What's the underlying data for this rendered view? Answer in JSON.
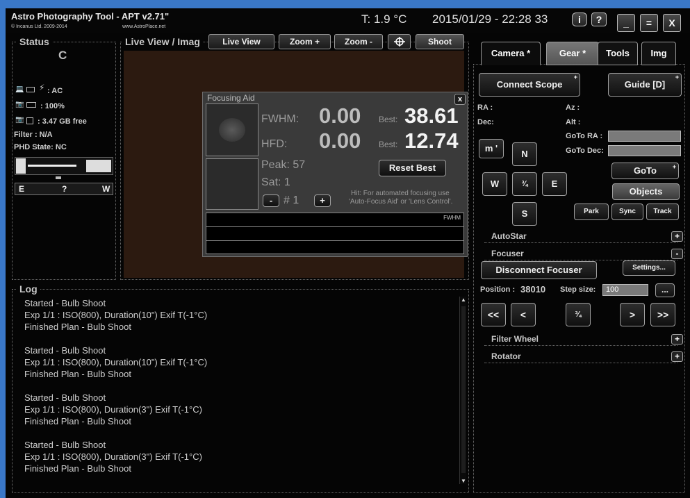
{
  "titlebar": {
    "app_title": "Astro Photography Tool - APT v2.71\"",
    "copyright": "© Incanus Ltd. 2009-2014",
    "website": "www.AstroPlace.net",
    "temperature": "T: 1.9 °C",
    "datetime": "2015/01/29 - 22:28 33",
    "info_label": "i",
    "help_label": "?",
    "minimize_label": "_",
    "maximize_label": "=",
    "close_label": "X"
  },
  "status": {
    "title": "Status",
    "connection_char": "C",
    "power": ": AC",
    "battery": ": 100%",
    "disk": ": 3.47 GB free",
    "filter": "Filter : N/A",
    "phd_state": "PHD State: NC",
    "compass": {
      "east": "E",
      "unknown": "?",
      "west": "W"
    }
  },
  "liveview": {
    "title": "Live View / Imag",
    "buttons": {
      "live_view": "Live View",
      "zoom_in": "Zoom +",
      "zoom_out": "Zoom -",
      "shoot": "Shoot"
    }
  },
  "focusing_aid": {
    "title": "Focusing Aid",
    "close_label": "x",
    "fwhm_label": "FWHM:",
    "fwhm_value": "0.00",
    "fwhm_best_label": "Best:",
    "fwhm_best": "38.61",
    "hfd_label": "HFD:",
    "hfd_value": "0.00",
    "hfd_best_label": "Best:",
    "hfd_best": "12.74",
    "peak_label": "Peak: 57",
    "sat_label": "Sat:   1",
    "reset_best": "Reset Best",
    "minus": "-",
    "plus": "+",
    "index": "#  1",
    "hint_line1": "Hit: For automated focusing use",
    "hint_line2": "'Auto-Focus Aid' or 'Lens Control'.",
    "graph_label": "FWHM"
  },
  "log": {
    "title": "Log",
    "lines": [
      "Started - Bulb Shoot",
      "Exp 1/1 : ISO(800), Duration(10\") Exif T(-1°C)",
      "Finished Plan - Bulb Shoot",
      "",
      "Started - Bulb Shoot",
      "Exp 1/1 : ISO(800), Duration(10\") Exif T(-1°C)",
      "Finished Plan - Bulb Shoot",
      "",
      "Started - Bulb Shoot",
      "Exp 1/1 : ISO(800), Duration(3\") Exif T(-1°C)",
      "Finished Plan - Bulb Shoot",
      "",
      "Started - Bulb Shoot",
      "Exp 1/1 : ISO(800), Duration(3\") Exif T(-1°C)",
      "Finished Plan - Bulb Shoot"
    ]
  },
  "tabs": {
    "camera": "Camera *",
    "gear": "Gear *",
    "tools": "Tools",
    "img": "Img"
  },
  "gear": {
    "connect_scope": "Connect Scope",
    "guide": "Guide [D]",
    "ra": "RA :",
    "dec": "Dec:",
    "az": "Az :",
    "alt": "Alt :",
    "goto_ra": "GoTo RA :",
    "goto_dec": "GoTo Dec:",
    "speed_btn": "m '",
    "north": "N",
    "west": "W",
    "center": "¾",
    "east": "E",
    "south": "S",
    "goto": "GoTo",
    "objects": "Objects",
    "park": "Park",
    "sync": "Sync",
    "track": "Track"
  },
  "sections": {
    "autostar": "AutoStar",
    "focuser": "Focuser",
    "filter_wheel": "Filter Wheel",
    "rotator": "Rotator",
    "expand": "+",
    "collapse": "-"
  },
  "focuser": {
    "disconnect": "Disconnect Focuser",
    "settings": "Settings...",
    "position_label": "Position :",
    "position_value": "38010",
    "step_label": "Step size:",
    "step_value": "100",
    "more": "...",
    "far_left": "<<",
    "left": "<",
    "center": "¾",
    "right": ">",
    "far_right": ">>"
  }
}
